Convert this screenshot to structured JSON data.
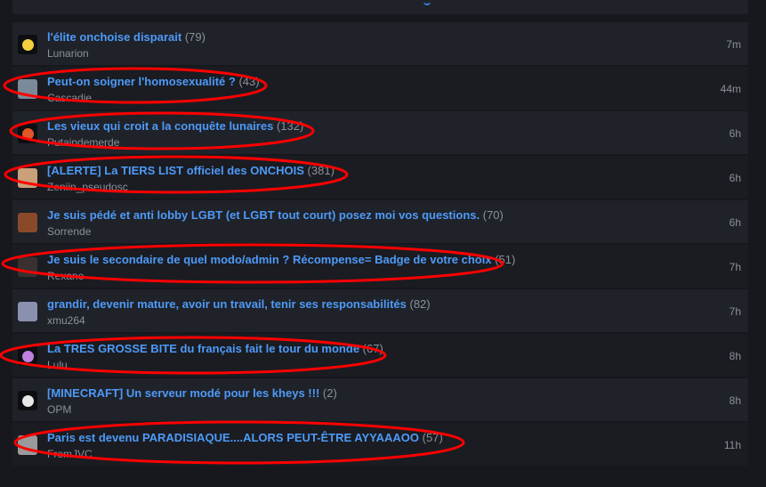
{
  "topics": [
    {
      "title": "l'élite onchoise disparait",
      "count": "(79)",
      "author": "Lunarion",
      "time": "7m",
      "avatar": "emoji-avatar",
      "avatar_color": "#f4d03f"
    },
    {
      "title": "Peut-on soigner l'homosexualité ?",
      "count": "(43)",
      "author": "Cascadie",
      "time": "44m",
      "avatar": "photo-avatar",
      "avatar_color": "#7a8a99"
    },
    {
      "title": "Les vieux qui croit a la conquête lunaires",
      "count": "(132)",
      "author": "Putaindemerde",
      "time": "6h",
      "avatar": "emoji-avatar",
      "avatar_color": "#e0572a"
    },
    {
      "title": "[ALERTE] La TIERS LIST officiel des ONCHOIS",
      "count": "(381)",
      "author": "Zeniin_pseudosc",
      "time": "6h",
      "avatar": "photo-avatar",
      "avatar_color": "#c9a07a"
    },
    {
      "title": "Je suis pédé et anti lobby LGBT (et LGBT tout court) posez moi vos questions.",
      "count": "(70)",
      "author": "Sorrende",
      "time": "6h",
      "avatar": "photo-avatar",
      "avatar_color": "#8a4a2a"
    },
    {
      "title": "Je suis le secondaire de quel modo/admin ? Récompense= Badge de votre choix",
      "count": "(51)",
      "author": "Rexane",
      "time": "7h",
      "avatar": "photo-avatar",
      "avatar_color": "#3a3030"
    },
    {
      "title": "grandir, devenir mature, avoir un travail, tenir ses responsabilités",
      "count": "(82)",
      "author": "xmu264",
      "time": "7h",
      "avatar": "photo-avatar",
      "avatar_color": "#8a90b0"
    },
    {
      "title": "La TRES GROSSE BITE du français fait le tour du monde",
      "count": "(67)",
      "author": "Lulu",
      "time": "8h",
      "avatar": "emoji-avatar",
      "avatar_color": "#c080e0"
    },
    {
      "title": "[MINECRAFT] Un serveur modé pour les kheys !!!",
      "count": "(2)",
      "author": "OPM",
      "time": "8h",
      "avatar": "emoji-avatar",
      "avatar_color": "#e8e8e8"
    },
    {
      "title": "Paris est devenu PARADISIAQUE....ALORS PEUT-ÊTRE AYYAAAOO",
      "count": "(57)",
      "author": "FromJVC",
      "time": "11h",
      "avatar": "photo-avatar",
      "avatar_color": "#9a9a9a"
    }
  ],
  "annotation_color": "#ff0000"
}
